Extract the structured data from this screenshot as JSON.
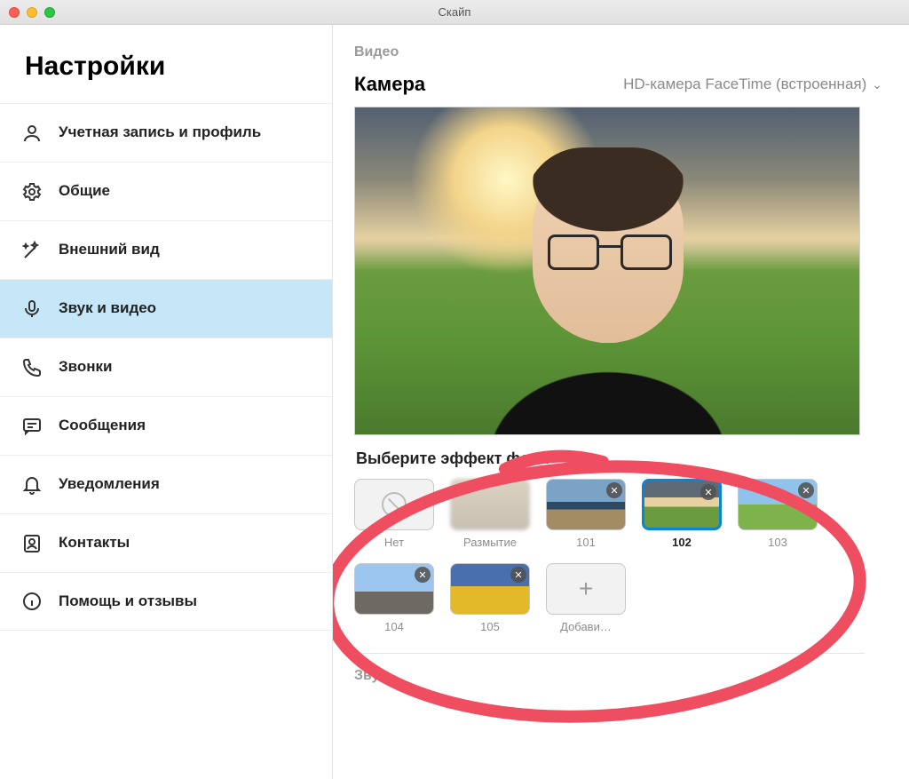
{
  "window": {
    "title": "Скайп"
  },
  "sidebar": {
    "title": "Настройки",
    "items": [
      {
        "label": "Учетная запись и профиль",
        "icon": "profile"
      },
      {
        "label": "Общие",
        "icon": "gear"
      },
      {
        "label": "Внешний вид",
        "icon": "wand"
      },
      {
        "label": "Звук и видео",
        "icon": "mic",
        "selected": true
      },
      {
        "label": "Звонки",
        "icon": "phone"
      },
      {
        "label": "Сообщения",
        "icon": "chat"
      },
      {
        "label": "Уведомления",
        "icon": "bell"
      },
      {
        "label": "Контакты",
        "icon": "contacts"
      },
      {
        "label": "Помощь и отзывы",
        "icon": "info"
      }
    ]
  },
  "content": {
    "video_section_label": "Видео",
    "camera_label": "Камера",
    "camera_selected": "HD-камера FaceTime (встроенная)",
    "bg_section_label": "Выберите эффект фона",
    "bg_effects": [
      {
        "id": "none",
        "label": "Нет",
        "removable": false,
        "selected": false
      },
      {
        "id": "blur",
        "label": "Размытие",
        "removable": false,
        "selected": false
      },
      {
        "id": "101",
        "label": "101",
        "removable": true,
        "selected": false
      },
      {
        "id": "102",
        "label": "102",
        "removable": true,
        "selected": true
      },
      {
        "id": "103",
        "label": "103",
        "removable": true,
        "selected": false
      },
      {
        "id": "104",
        "label": "104",
        "removable": true,
        "selected": false
      },
      {
        "id": "105",
        "label": "105",
        "removable": true,
        "selected": false
      },
      {
        "id": "add",
        "label": "Добави…",
        "removable": false,
        "selected": false
      }
    ],
    "sound_section_label": "Звук"
  }
}
